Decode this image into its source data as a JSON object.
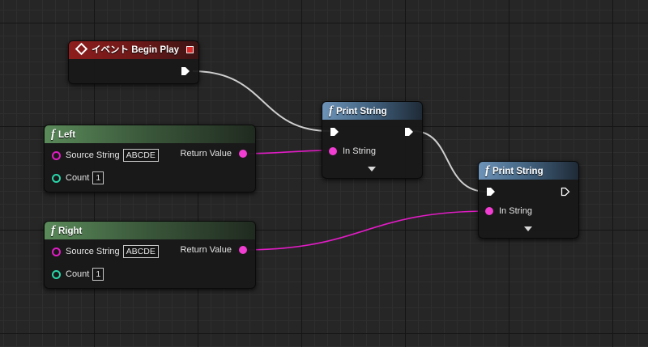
{
  "nodes": {
    "begin_play": {
      "title": "イベント Begin Play"
    },
    "left": {
      "title": "Left",
      "source_string_label": "Source String",
      "source_string_value": "ABCDE",
      "count_label": "Count",
      "count_value": "1",
      "return_label": "Return Value"
    },
    "right": {
      "title": "Right",
      "source_string_label": "Source String",
      "source_string_value": "ABCDE",
      "count_label": "Count",
      "count_value": "1",
      "return_label": "Return Value"
    },
    "print_string_1": {
      "title": "Print String",
      "in_string_label": "In String"
    },
    "print_string_2": {
      "title": "Print String",
      "in_string_label": "In String"
    }
  },
  "function_glyph": "f",
  "colors": {
    "exec_wire": "#cfcfcf",
    "string_wire": "#e01cc4",
    "string_pin": "#f13dd1",
    "int_pin": "#29d6a8",
    "event_header": "#8e1d1d",
    "pure_header": "#5a8a5a",
    "function_header": "#6d93b8"
  }
}
